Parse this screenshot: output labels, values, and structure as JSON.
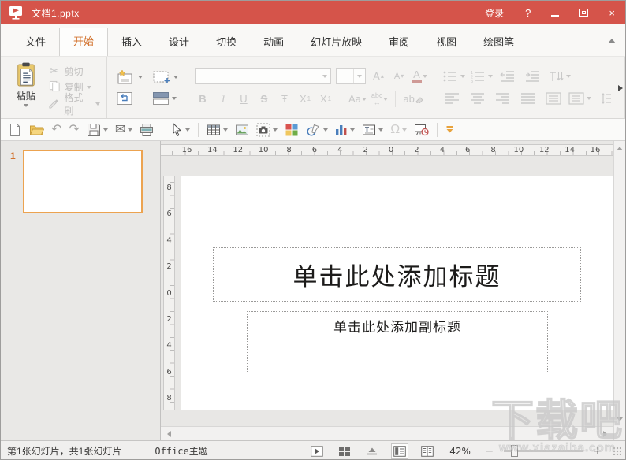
{
  "titlebar": {
    "title": "文档1.pptx",
    "login": "登录",
    "help": "?",
    "close": "×"
  },
  "tabs": [
    {
      "label": "文件",
      "active": false
    },
    {
      "label": "开始",
      "active": true
    },
    {
      "label": "插入",
      "active": false
    },
    {
      "label": "设计",
      "active": false
    },
    {
      "label": "切换",
      "active": false
    },
    {
      "label": "动画",
      "active": false
    },
    {
      "label": "幻灯片放映",
      "active": false
    },
    {
      "label": "审阅",
      "active": false
    },
    {
      "label": "视图",
      "active": false
    },
    {
      "label": "绘图笔",
      "active": false
    }
  ],
  "ribbon": {
    "paste_label": "粘贴",
    "cut_label": "剪切",
    "copy_label": "复制",
    "format_painter_label": "格式刷",
    "glyphs": {
      "cut": "✂",
      "bold": "B",
      "italic": "I",
      "underline": "U",
      "strikethrough": "S",
      "t_strike": "Ŧ",
      "x": "X",
      "one": "1",
      "change_case": "Aa",
      "char_spacing_text": "abc",
      "char_spacing_arrow": "↔",
      "clear_format_text": "ab",
      "font_letter": "A",
      "grow_arrow": "▴",
      "shrink_arrow": "▾"
    },
    "font_name_value": "",
    "font_size_value": ""
  },
  "quickbar": {
    "glyphs": {
      "undo": "↶",
      "redo": "↷",
      "email": "✉",
      "omega": "Ω"
    }
  },
  "ruler_h": [
    "16",
    "14",
    "12",
    "10",
    "8",
    "6",
    "4",
    "2",
    "0",
    "2",
    "4",
    "6",
    "8",
    "10",
    "12",
    "14",
    "16"
  ],
  "ruler_v": [
    "8",
    "6",
    "4",
    "2",
    "0",
    "2",
    "4",
    "6",
    "8"
  ],
  "slide_panel": {
    "slide_number": "1"
  },
  "slide": {
    "title_placeholder": "单击此处添加标题",
    "subtitle_placeholder": "单击此处添加副标题"
  },
  "statusbar": {
    "slide_info": "第1张幻灯片，共1张幻灯片",
    "theme": "Office主题",
    "zoom_level": "42%",
    "zoom_out": "−",
    "zoom_in": "+"
  },
  "watermark": {
    "text": "下载吧",
    "site": "www.xiazaiba.com"
  },
  "colors": {
    "titlebar_red": "#d5544a",
    "active_tab_orange": "#d2722e",
    "thumbnail_border_orange": "#eca350",
    "folder_yellow": "#f0c75e",
    "chart_blue": "#4a7ebb",
    "chart_red": "#c0504d",
    "more_button_orange": "#e8a33d"
  }
}
